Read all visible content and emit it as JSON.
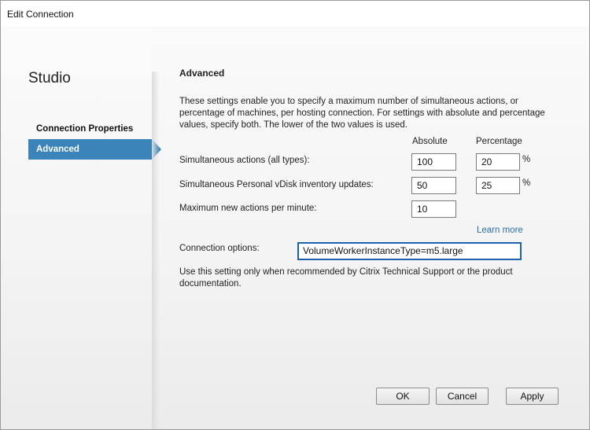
{
  "window": {
    "title": "Edit Connection"
  },
  "sidebar": {
    "app_name": "Studio",
    "items": [
      {
        "label": "Connection Properties",
        "selected": false
      },
      {
        "label": "Advanced",
        "selected": true
      }
    ]
  },
  "main": {
    "heading": "Advanced",
    "description": "These settings enable you to specify a maximum number of simultaneous actions, or percentage of machines, per hosting connection. For settings with absolute and percentage values, specify both. The lower of the two values is used.",
    "columns": {
      "absolute": "Absolute",
      "percentage": "Percentage"
    },
    "rows": [
      {
        "label": "Simultaneous actions (all types):",
        "absolute": "100",
        "percentage": "20",
        "unit": "%"
      },
      {
        "label": "Simultaneous Personal vDisk inventory updates:",
        "absolute": "50",
        "percentage": "25",
        "unit": "%"
      },
      {
        "label": "Maximum new actions per minute:",
        "absolute": "10"
      }
    ],
    "learn_more": "Learn more",
    "connection_options": {
      "label": "Connection options:",
      "value": "VolumeWorkerInstanceType=m5.large"
    },
    "note": "Use this setting only when recommended by Citrix Technical Support or the product documentation."
  },
  "buttons": {
    "ok": "OK",
    "cancel": "Cancel",
    "apply": "Apply"
  },
  "colors": {
    "accent": "#3a84ba",
    "link": "#2a6ea8",
    "focus_border": "#1b62a9"
  }
}
